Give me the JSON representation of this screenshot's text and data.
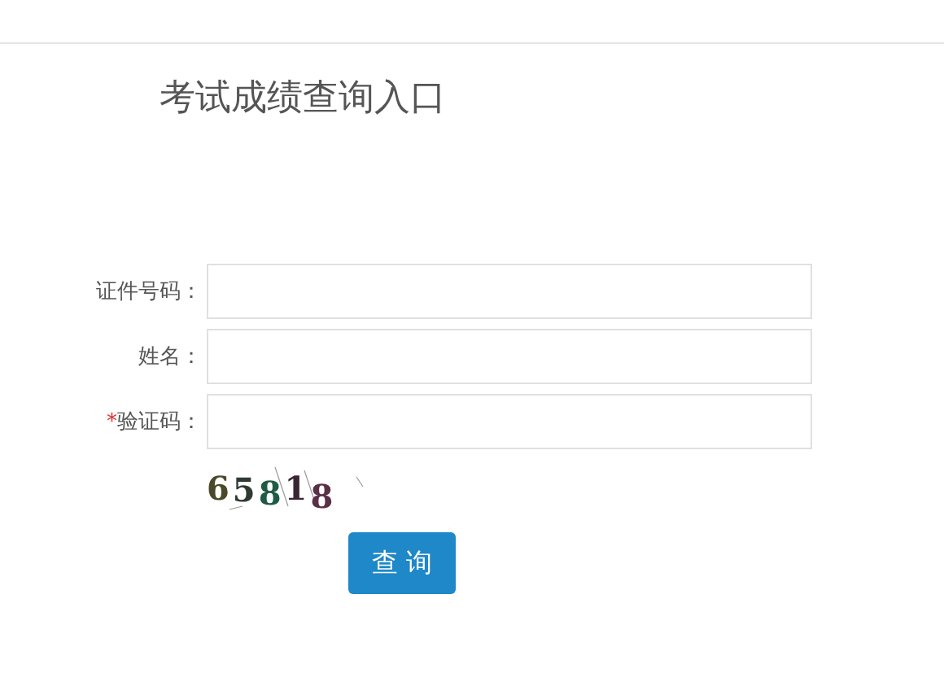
{
  "title": "考试成绩查询入口",
  "fields": [
    {
      "label": "证件号码："
    },
    {
      "label": "姓名："
    },
    {
      "label": "验证码：",
      "required_mark": "*"
    }
  ],
  "captcha": {
    "code": "65818"
  },
  "button": {
    "label": "查 询"
  }
}
